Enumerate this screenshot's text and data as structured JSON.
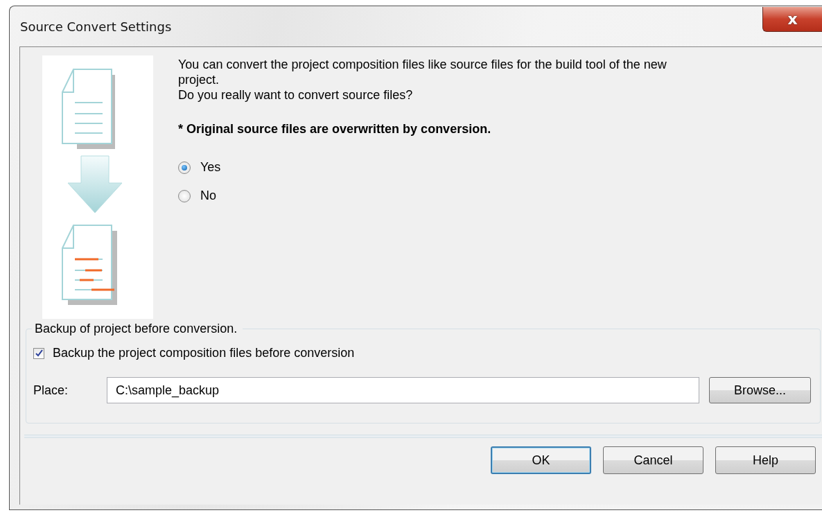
{
  "window": {
    "title": "Source Convert Settings",
    "close": "x"
  },
  "message": [
    "You can convert the project composition files like source files for the build tool of the new project.",
    "Do you really want to convert source files?"
  ],
  "warning": "* Original source files are overwritten by conversion.",
  "options": [
    {
      "label": "Yes",
      "selected": true
    },
    {
      "label": "No",
      "selected": false
    }
  ],
  "backup": {
    "legend": "Backup of project before conversion.",
    "checkbox": {
      "label": "Backup the project composition files before conversion",
      "checked": true
    },
    "place": {
      "label": "Place:",
      "value": "C:\\sample_backup"
    },
    "browse": "Browse..."
  },
  "buttons": [
    {
      "label": "OK",
      "default": true
    },
    {
      "label": "Cancel",
      "default": false
    },
    {
      "label": "Help",
      "default": false
    }
  ]
}
